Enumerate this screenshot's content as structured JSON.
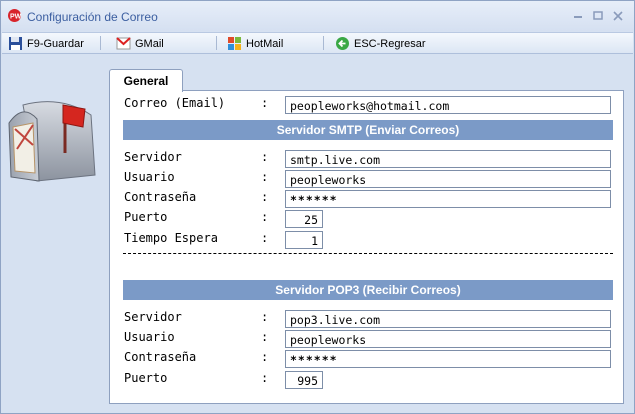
{
  "window": {
    "title": "Configuración de Correo"
  },
  "toolbar": {
    "save_label": "F9-Guardar",
    "gmail_label": "GMail",
    "hotmail_label": "HotMail",
    "back_label": "ESC-Regresar"
  },
  "tab": {
    "label": "General"
  },
  "email": {
    "label": "Correo (Email)",
    "value": "peopleworks@hotmail.com"
  },
  "smtp": {
    "header": "Servidor SMTP (Enviar Correos)",
    "server_label": "Servidor",
    "server_value": "smtp.live.com",
    "user_label": "Usuario",
    "user_value": "peopleworks",
    "password_label": "Contraseña",
    "password_value": "******",
    "port_label": "Puerto",
    "port_value": "25",
    "timeout_label": "Tiempo Espera",
    "timeout_value": "1"
  },
  "pop3": {
    "header": "Servidor POP3 (Recibir Correos)",
    "server_label": "Servidor",
    "server_value": "pop3.live.com",
    "user_label": "Usuario",
    "user_value": "peopleworks",
    "password_label": "Contraseña",
    "password_value": "******",
    "port_label": "Puerto",
    "port_value": "995"
  },
  "colon": ":"
}
